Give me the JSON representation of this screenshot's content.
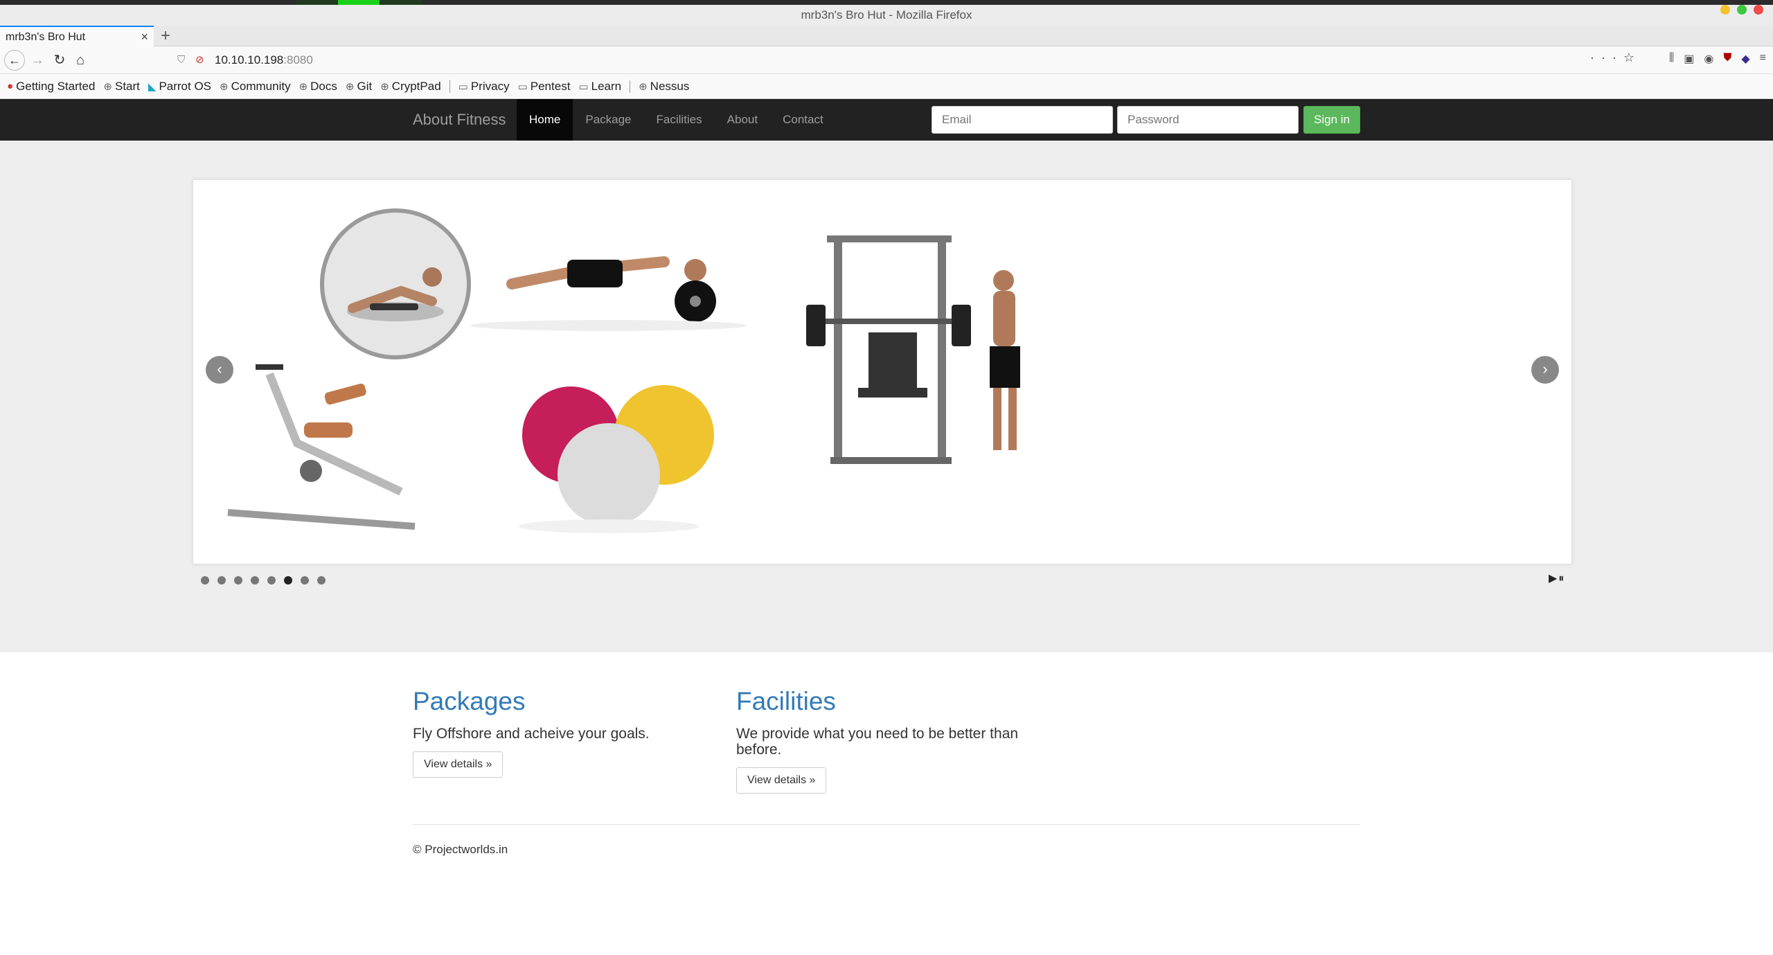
{
  "window": {
    "title": "mrb3n's Bro Hut - Mozilla Firefox"
  },
  "tab": {
    "title": "mrb3n's Bro Hut",
    "close": "×",
    "new": "+"
  },
  "nav": {
    "back": "←",
    "forward": "→",
    "reload": "↻",
    "home": "⌂"
  },
  "url": {
    "host": "10.10.10.198",
    "port": ":8080",
    "more": "···",
    "star": "☆"
  },
  "bookmarks": [
    {
      "label": "Getting Started",
      "icon": "●"
    },
    {
      "label": "Start",
      "icon": "⊕"
    },
    {
      "label": "Parrot OS",
      "icon": "◣"
    },
    {
      "label": "Community",
      "icon": "⊕"
    },
    {
      "label": "Docs",
      "icon": "⊕"
    },
    {
      "label": "Git",
      "icon": "⊕"
    },
    {
      "label": "CryptPad",
      "icon": "⊕"
    },
    {
      "label": "Privacy",
      "icon": "▭"
    },
    {
      "label": "Pentest",
      "icon": "▭"
    },
    {
      "label": "Learn",
      "icon": "▭"
    },
    {
      "label": "Nessus",
      "icon": "⊕"
    }
  ],
  "site": {
    "brand": "About Fitness",
    "menu": [
      "Home",
      "Package",
      "Facilities",
      "About",
      "Contact"
    ],
    "email_placeholder": "Email",
    "password_placeholder": "Password",
    "signin": "Sign in"
  },
  "slider": {
    "prev": "‹",
    "next": "›",
    "dots_count": 8,
    "active_dot": 6,
    "controls": "▶⏸"
  },
  "sections": [
    {
      "title": "Packages",
      "text": "Fly Offshore and acheive your goals.",
      "button": "View details »"
    },
    {
      "title": "Facilities",
      "text": "We provide what you need to be better than before.",
      "button": "View details »"
    }
  ],
  "footer": "© Projectworlds.in",
  "colors": {
    "nav_bg": "#222222",
    "signin": "#5cb85c",
    "heading": "#337ab7",
    "hero_bg": "#eeeeee"
  }
}
